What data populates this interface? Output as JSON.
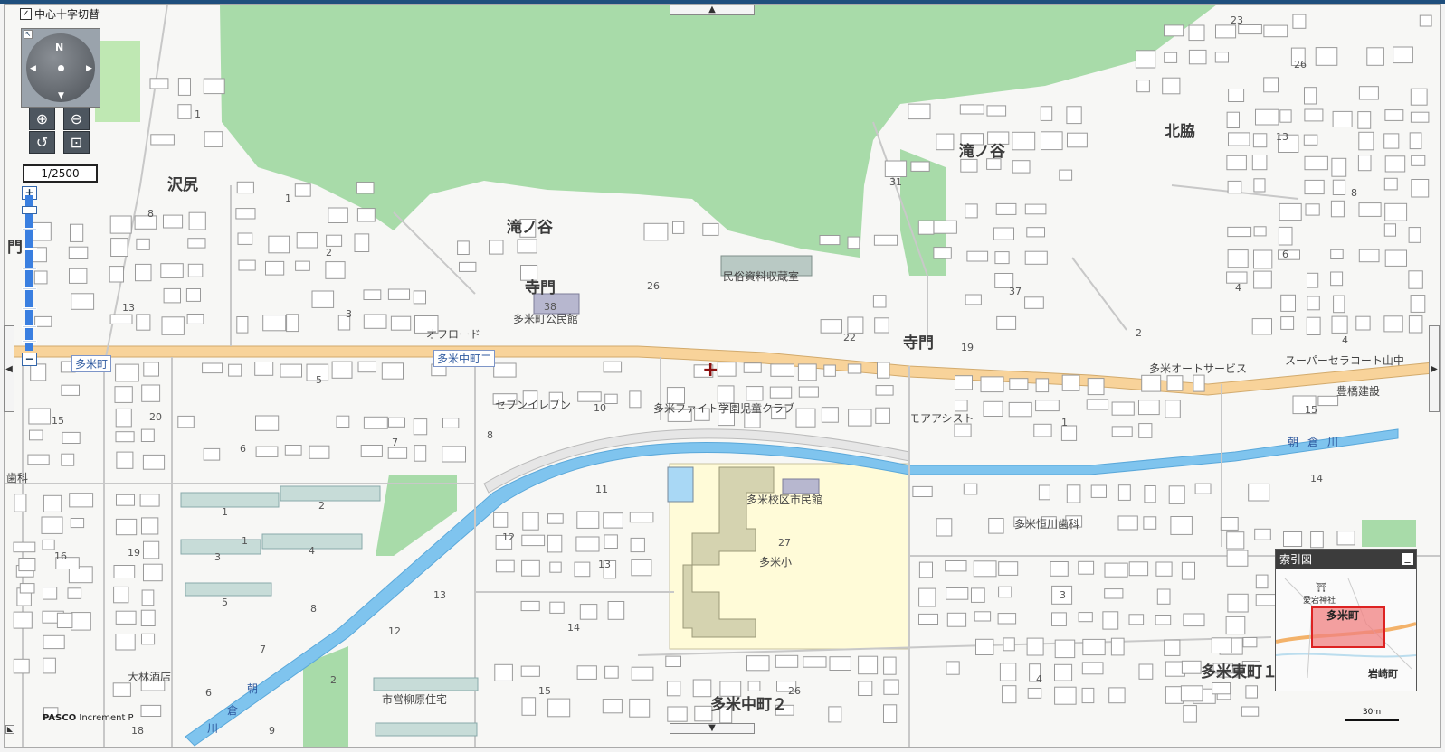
{
  "controls": {
    "crosshair_toggle_label": "中心十字切替",
    "crosshair_checked": "✓",
    "compass_north": "N",
    "scale_value": "1/2500",
    "zoom_in_symbol": "+",
    "zoom_out_symbol": "−"
  },
  "labels": {
    "area": {
      "sawajiri": "沢尻",
      "takinotani_1": "滝ノ谷",
      "takinotani_2": "滝ノ谷",
      "teramon_1": "寺門",
      "teramon_2": "寺門",
      "kitawaki": "北脇",
      "tame_nakamachi_2": "多米中町２",
      "tame_higashimachi_1": "多米東町１",
      "mon_edge": "門"
    },
    "facilities": {
      "museum": "民俗資料収蔵室",
      "community_hall": "多米町公民館",
      "offroad": "オフロード",
      "seven_eleven": "セブンイレブン",
      "kids_club": "多米ファイト学園児童クラブ",
      "moa_assist": "モアアシスト",
      "auto_service": "多米オートサービス",
      "super": "スーパーセラコート山中",
      "toyohashi_const": "豊橋建設",
      "civic_center": "多米校区市民館",
      "school": "多米小",
      "dental": "多米恒川歯科",
      "omura_sake": "大林酒店",
      "public_housing": "市営柳原住宅",
      "dental_edge": "歯科"
    },
    "roads": {
      "tame_cho": "多米町",
      "tame_nakamachi": "多米中町二"
    },
    "river": {
      "asakura": "朝倉川",
      "asa_1": "朝",
      "asa_2": "倉",
      "asa_3": "川"
    },
    "numbers": {
      "n1": "1",
      "n2": "2",
      "n3": "3",
      "n4": "4",
      "n5": "5",
      "n6": "6",
      "n7": "7",
      "n8": "8",
      "n9": "9",
      "n10": "10",
      "n11": "11",
      "n12": "12",
      "n13": "13",
      "n14": "14",
      "n15": "15",
      "n16": "16",
      "n18": "18",
      "n19": "19",
      "n20": "20",
      "n22": "22",
      "n23": "23",
      "n26": "26",
      "n27": "27",
      "n31": "31",
      "n37": "37",
      "n38": "38"
    }
  },
  "overview": {
    "title": "索引図",
    "minimize_symbol": "_",
    "shrine": "愛宕神社",
    "shrine_symbol": "⛩",
    "tame_cho": "多米町",
    "iwasaki_cho": "岩崎町"
  },
  "credits": {
    "provider": "PASCO",
    "partner": "Increment P",
    "scale_text": "30m"
  },
  "colors": {
    "forest": "#a8dba9",
    "main_road": "#f8d39a",
    "river": "#7fc4ee",
    "school": "#fffbd8",
    "building": "#ffffff",
    "building_edge": "#9a9a9a",
    "overview_highlight": "#f08080"
  }
}
